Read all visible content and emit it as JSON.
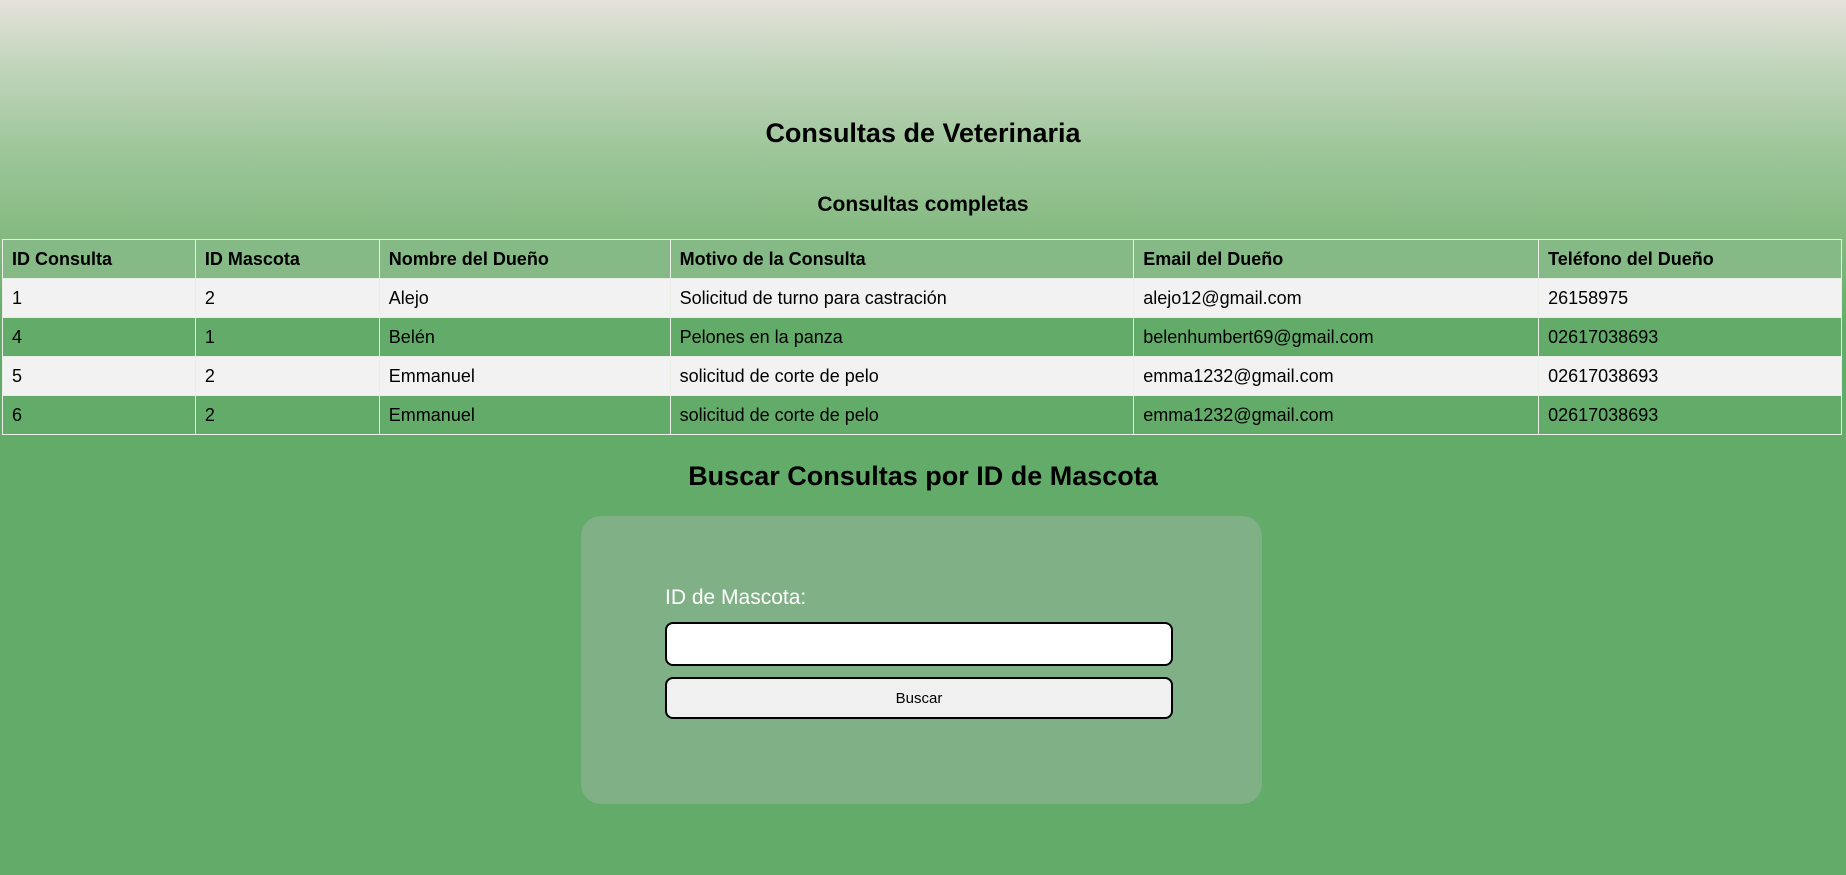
{
  "header": {
    "title": "Consultas de Veterinaria",
    "subtitle": "Consultas completas"
  },
  "table": {
    "columns": [
      "ID Consulta",
      "ID Mascota",
      "Nombre del Dueño",
      "Motivo de la Consulta",
      "Email del Dueño",
      "Teléfono del Dueño"
    ],
    "rows": [
      [
        "1",
        "2",
        "Alejo",
        "Solicitud de turno para castración",
        "alejo12@gmail.com",
        "26158975"
      ],
      [
        "4",
        "1",
        "Belén",
        "Pelones en la panza",
        "belenhumbert69@gmail.com",
        "02617038693"
      ],
      [
        "5",
        "2",
        "Emmanuel",
        "solicitud de corte de pelo",
        "emma1232@gmail.com",
        "02617038693"
      ],
      [
        "6",
        "2",
        "Emmanuel",
        "solicitud de corte de pelo",
        "emma1232@gmail.com",
        "02617038693"
      ]
    ]
  },
  "search": {
    "title": "Buscar Consultas por ID de Mascota",
    "label": "ID de Mascota:",
    "input_value": "",
    "button_label": "Buscar"
  },
  "colors": {
    "background_green": "#63ab68",
    "header_row": "#85b986",
    "card": "#80b086",
    "row_light": "#f2f2f2"
  }
}
